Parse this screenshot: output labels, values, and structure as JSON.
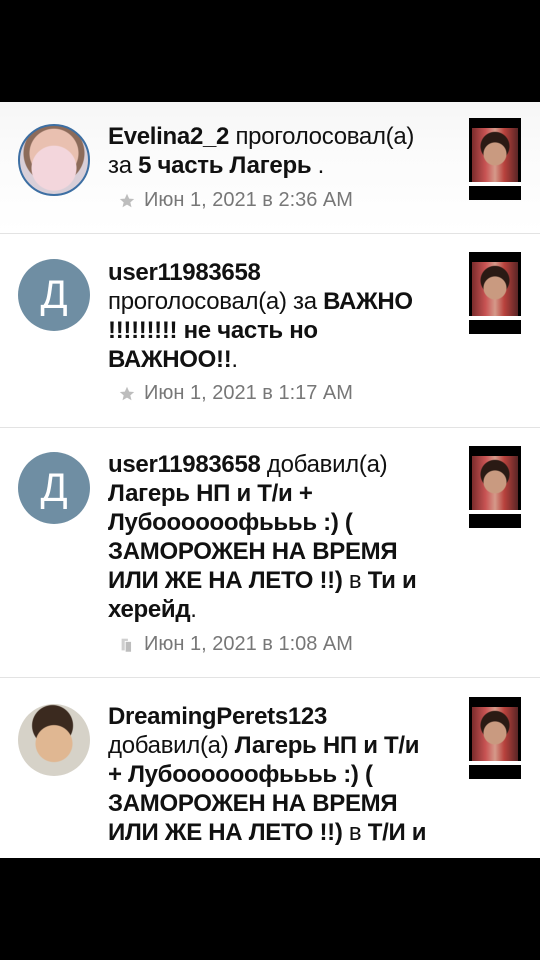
{
  "feed": {
    "items": [
      {
        "user": "Evelina2_2",
        "pre": " проголосовал(а) за ",
        "target": "5 часть Лагерь",
        "post": " .",
        "meta": "Июн 1, 2021 в 2:36 AM",
        "meta_icon": "star-icon"
      },
      {
        "avatar_letter": "Д",
        "user": "user11983658",
        "pre": " проголосовал(а) за ",
        "target": "ВАЖНО !!!!!!!!! не часть но ВАЖНОО!!",
        "post": ".",
        "meta": "Июн 1, 2021 в 1:17 AM",
        "meta_icon": "star-icon"
      },
      {
        "avatar_letter": "Д",
        "user": "user11983658",
        "pre": " добавил(а) ",
        "target": "Лагерь НП и Т/и + Лубоооооофьььь :) ( ЗАМОРОЖЕН НА ВРЕМЯ ИЛИ ЖЕ НА ЛЕТО !!)",
        "mid": " в ",
        "list": "Ти и херейд",
        "post": ".",
        "meta": "Июн 1, 2021 в 1:08 AM",
        "meta_icon": "library-icon"
      },
      {
        "user": "DreamingPerets123",
        "pre": " добавил(а) ",
        "target": "Лагерь НП и Т/и + Лубоооооофьььь :) ( ЗАМОРОЖЕН НА ВРЕМЯ ИЛИ ЖЕ НА ЛЕТО !!)",
        "mid": " в ",
        "list": "Т/И и"
      }
    ]
  }
}
